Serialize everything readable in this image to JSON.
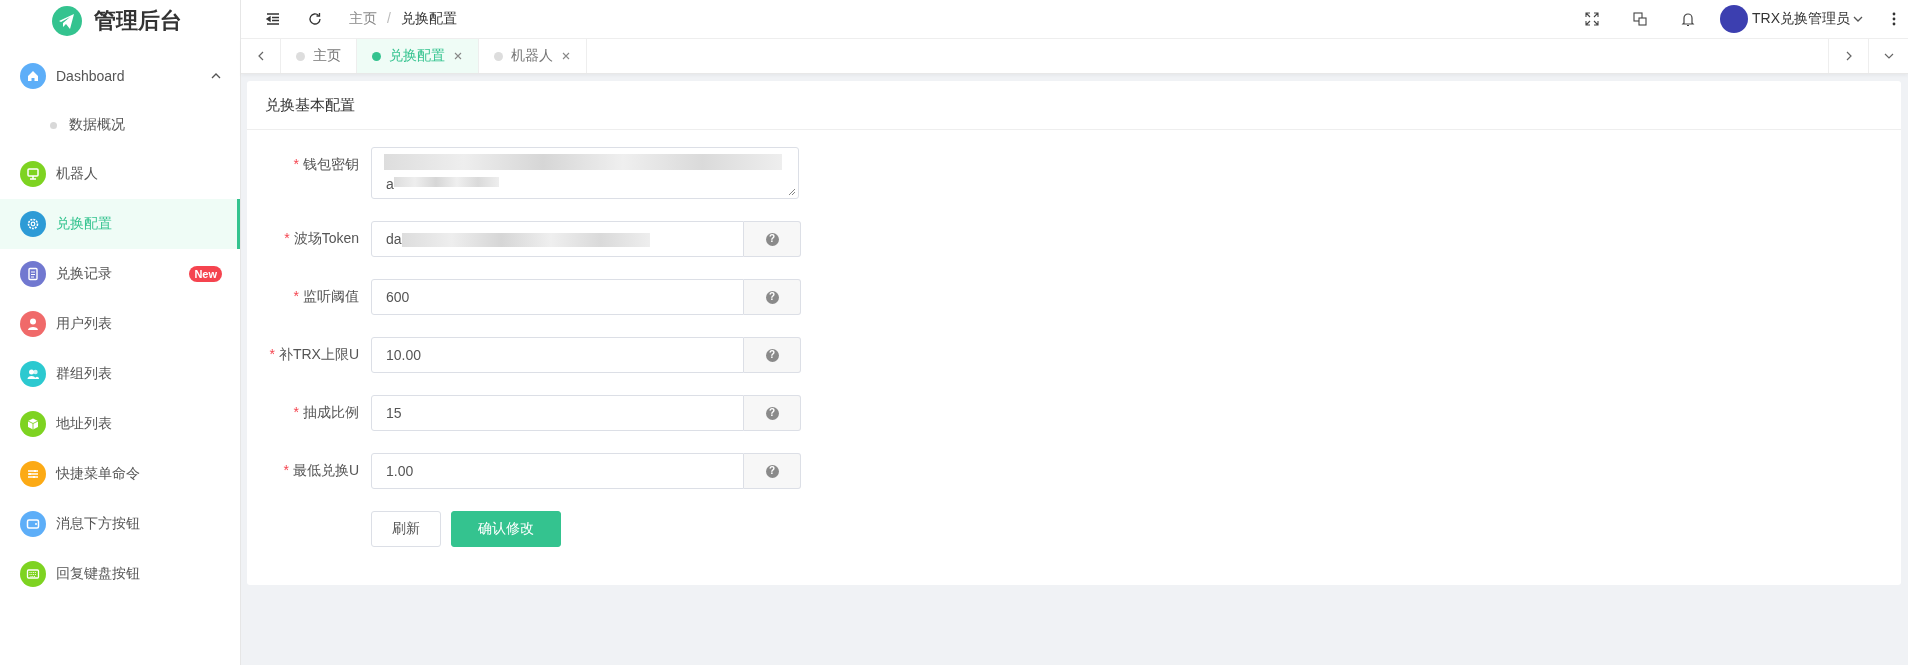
{
  "brand": {
    "title": "管理后台"
  },
  "sidebar": {
    "items": [
      {
        "label": "Dashboard",
        "color": "#5daef8",
        "selected": false,
        "expanded": true,
        "children": [
          {
            "label": "数据概况",
            "selected": false
          }
        ]
      },
      {
        "label": "机器人",
        "color": "#7ed321",
        "selected": false
      },
      {
        "label": "兑换配置",
        "color": "#2d9bd6",
        "selected": true
      },
      {
        "label": "兑换记录",
        "color": "#7178d0",
        "selected": false,
        "badge": "New"
      },
      {
        "label": "用户列表",
        "color": "#f06a6a",
        "selected": false
      },
      {
        "label": "群组列表",
        "color": "#2cc9d0",
        "selected": false
      },
      {
        "label": "地址列表",
        "color": "#7ed321",
        "selected": false
      },
      {
        "label": "快捷菜单命令",
        "color": "#fcaa15",
        "selected": false
      },
      {
        "label": "消息下方按钮",
        "color": "#5daef8",
        "selected": false
      },
      {
        "label": "回复键盘按钮",
        "color": "#7ed321",
        "selected": false
      }
    ]
  },
  "breadcrumb": {
    "items": [
      "主页",
      "兑换配置"
    ],
    "separator": "/"
  },
  "user": {
    "name": "TRX兑换管理员"
  },
  "tabs": [
    {
      "label": "主页",
      "selected": false,
      "closable": false
    },
    {
      "label": "兑换配置",
      "selected": true,
      "closable": true
    },
    {
      "label": "机器人",
      "selected": false,
      "closable": true
    }
  ],
  "card": {
    "title": "兑换基本配置",
    "fields": [
      {
        "kind": "textarea",
        "required_mark": "*",
        "label": "钱包密钥",
        "value": "a",
        "blurred": true
      },
      {
        "kind": "input",
        "required_mark": "*",
        "label": "波场Token",
        "value": "da",
        "blurred": true,
        "help": "?"
      },
      {
        "kind": "input",
        "required_mark": "*",
        "label": "监听阈值",
        "value": "600",
        "help": "?"
      },
      {
        "kind": "input",
        "required_mark": "*",
        "label": "补TRX上限U",
        "value": "10.00",
        "help": "?"
      },
      {
        "kind": "input",
        "required_mark": "*",
        "label": "抽成比例",
        "value": "15",
        "help": "?"
      },
      {
        "kind": "input",
        "required_mark": "*",
        "label": "最低兑换U",
        "value": "1.00",
        "help": "?"
      }
    ],
    "buttons": [
      {
        "label": "刷新",
        "kind": "default"
      },
      {
        "label": "确认修改",
        "kind": "primary"
      }
    ]
  }
}
